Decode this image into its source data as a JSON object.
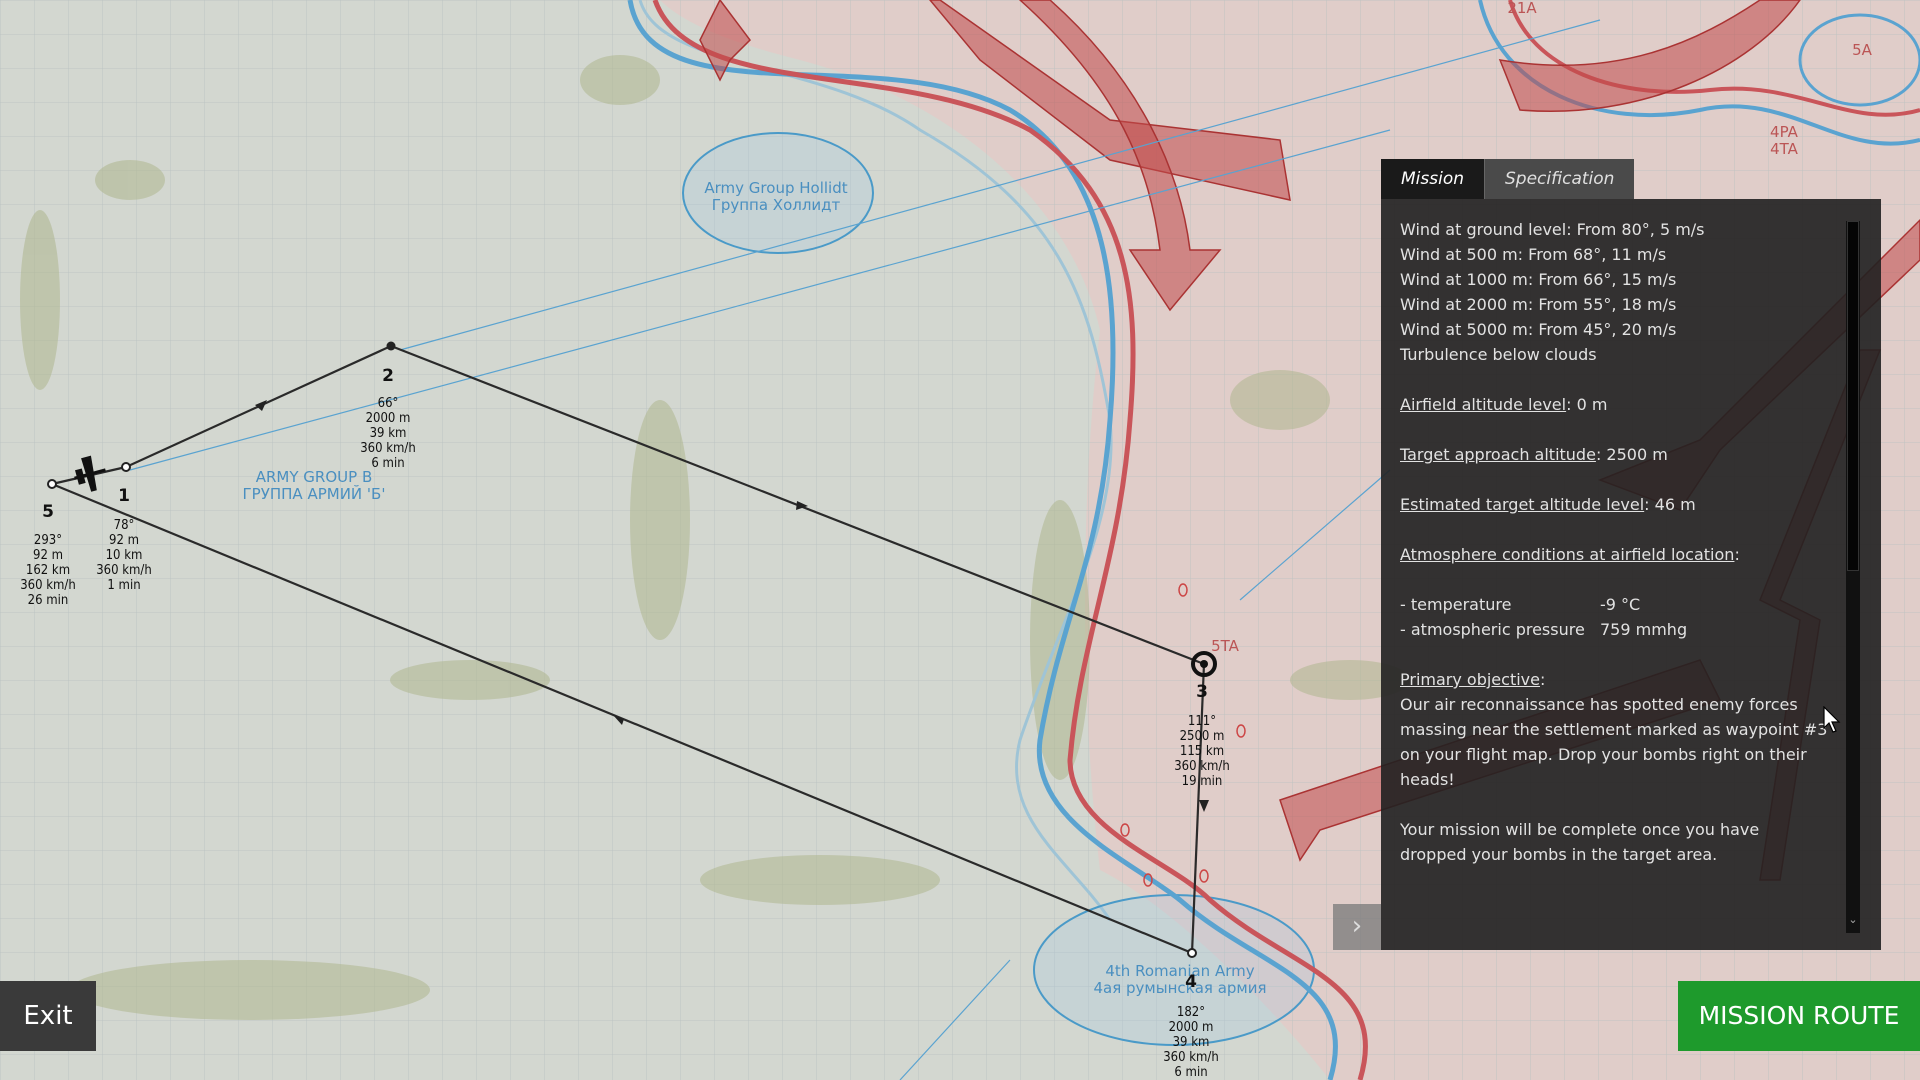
{
  "map": {
    "regions": [
      {
        "line1": "Army Group Hollidt",
        "line2": "Группа Холлидт"
      },
      {
        "line1": "ARMY GROUP B",
        "line2": "ГРУППА АРМИЙ 'Б'"
      },
      {
        "line1": "4th Romanian Army",
        "line2": "4ая румынская армия"
      }
    ],
    "front_labels": [
      "5TA",
      "21A",
      "4PA",
      "4TA",
      "5A"
    ],
    "waypoints": [
      {
        "num": "1",
        "lines": [
          "78°",
          "92 m",
          "10 km",
          "360 km/h",
          "1 min"
        ]
      },
      {
        "num": "2",
        "lines": [
          "66°",
          "2000 m",
          "39 km",
          "360 km/h",
          "6 min"
        ]
      },
      {
        "num": "3",
        "lines": [
          "111°",
          "2500 m",
          "115 km",
          "360 km/h",
          "19 min"
        ]
      },
      {
        "num": "4",
        "lines": [
          "182°",
          "2000 m",
          "39 km",
          "360 km/h",
          "6 min"
        ]
      },
      {
        "num": "5",
        "lines": [
          "293°",
          "92 m",
          "162 km",
          "360 km/h",
          "26 min"
        ]
      }
    ],
    "colors": {
      "friendly": "#4a9ac8",
      "enemy": "#c44a4a",
      "route": "#2a2a2a"
    }
  },
  "panel": {
    "tabs": {
      "mission": "Mission",
      "specification": "Specification",
      "active": "mission"
    },
    "wind": [
      "Wind at ground level: From 80°, 5 m/s",
      "Wind at 500 m: From 68°, 11 m/s",
      "Wind at 1000 m: From 66°, 15 m/s",
      "Wind at 2000 m: From 55°, 18 m/s",
      "Wind at 5000 m: From 45°, 20 m/s",
      "Turbulence below clouds"
    ],
    "airfield_alt_label": "Airfield altitude level",
    "airfield_alt_value": ": 0 m",
    "approach_label": "Target approach altitude",
    "approach_value": ": 2500 m",
    "target_alt_label": "Estimated target altitude level",
    "target_alt_value": ": 46 m",
    "atmo_label": "Atmosphere conditions at airfield location",
    "atmo_colon": ":",
    "temp_key": " - temperature",
    "temp_val": "-9 °C",
    "pressure_key": " - atmospheric pressure",
    "pressure_val": "759 mmhg",
    "objective_label": "Primary objective",
    "objective_colon": ":",
    "objective_text": "Our air reconnaissance has spotted enemy forces massing near the settlement marked as waypoint #3 on your flight map. Drop your bombs right on their heads!",
    "completion_text": "Your mission will be complete once you have dropped your bombs in the target area.",
    "scroll_up_icon": "chevron-up-icon",
    "scroll_down_icon": "chevron-down-icon",
    "collapse_icon": "chevron-right-icon"
  },
  "buttons": {
    "exit": "Exit",
    "mission_route": "MISSION ROUTE"
  },
  "accent_green": "#1e9a2c"
}
